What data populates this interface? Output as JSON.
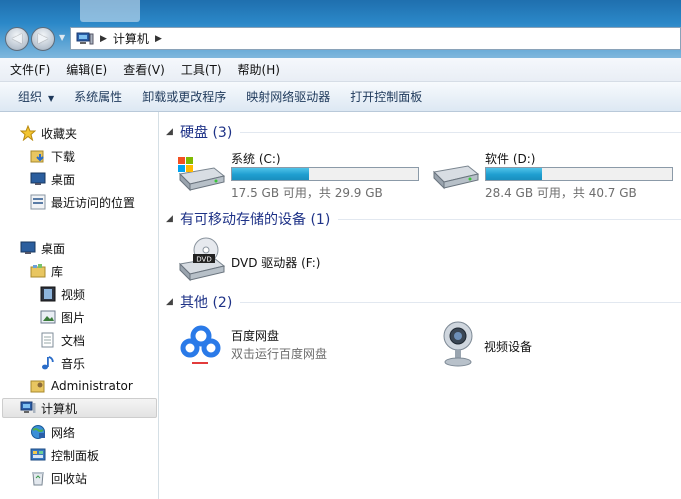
{
  "address": {
    "path": "计算机"
  },
  "menubar": {
    "items": [
      "文件(F)",
      "编辑(E)",
      "查看(V)",
      "工具(T)",
      "帮助(H)"
    ]
  },
  "commandbar": {
    "items": [
      "组织",
      "系统属性",
      "卸载或更改程序",
      "映射网络驱动器",
      "打开控制面板"
    ]
  },
  "navpane": {
    "favorites": "收藏夹",
    "downloads": "下载",
    "desktop_fav": "桌面",
    "recent": "最近访问的位置",
    "desktop": "桌面",
    "library": "库",
    "videos": "视频",
    "pictures": "图片",
    "documents": "文档",
    "music": "音乐",
    "admin": "Administrator",
    "computer": "计算机",
    "network": "网络",
    "control_panel": "控制面板",
    "recycle_bin": "回收站"
  },
  "groups": {
    "hdd": "硬盘 (3)",
    "removable": "有可移动存储的设备 (1)",
    "other": "其他 (2)"
  },
  "drives": [
    {
      "name": "系统 (C:)",
      "size": "17.5 GB 可用，共 29.9 GB",
      "used_fraction": 0.415
    },
    {
      "name": "软件 (D:)",
      "size": "28.4 GB 可用，共 40.7 GB",
      "used_fraction": 0.302
    }
  ],
  "dvd": {
    "name": "DVD 驱动器 (F:)"
  },
  "other_items": {
    "baidu_name": "百度网盘",
    "baidu_sub": "双击运行百度网盘",
    "camera_name": "视频设备"
  },
  "colors": {
    "group_title": "#1e3287",
    "drive_fill": "#1f9ed0",
    "title_bar": "#2b88c8"
  }
}
